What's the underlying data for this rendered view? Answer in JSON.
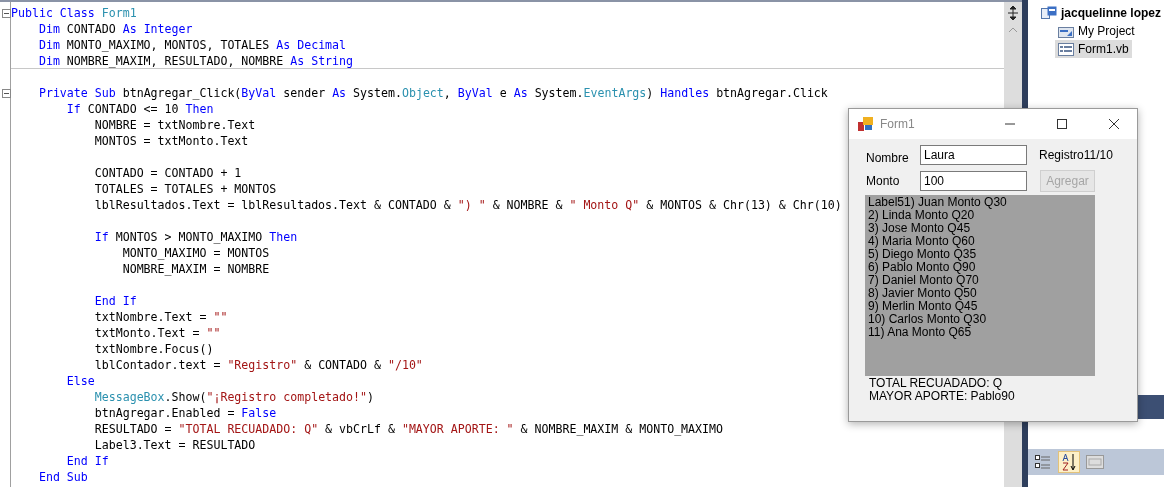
{
  "editor": {
    "lines": [
      {
        "kind": "code",
        "foldable": true,
        "tokens": [
          {
            "kind": "keyword",
            "text": "Public Class "
          },
          {
            "kind": "type",
            "text": "Form1"
          }
        ]
      },
      {
        "kind": "code",
        "tokens": [
          {
            "kind": "keyword",
            "text": "    Dim "
          },
          {
            "kind": "plain",
            "text": "CONTADO "
          },
          {
            "kind": "keyword",
            "text": "As Integer"
          }
        ]
      },
      {
        "kind": "code",
        "tokens": [
          {
            "kind": "keyword",
            "text": "    Dim "
          },
          {
            "kind": "plain",
            "text": "MONTO_MAXIMO, MONTOS, TOTALES "
          },
          {
            "kind": "keyword",
            "text": "As Decimal"
          }
        ]
      },
      {
        "kind": "code",
        "separator": true,
        "tokens": [
          {
            "kind": "keyword",
            "text": "    Dim "
          },
          {
            "kind": "plain",
            "text": "NOMBRE_MAXIM, RESULTADO, NOMBRE "
          },
          {
            "kind": "keyword",
            "text": "As String"
          }
        ]
      },
      {
        "kind": "blank"
      },
      {
        "kind": "code",
        "foldable": true,
        "tokens": [
          {
            "kind": "keyword",
            "text": "    Private Sub "
          },
          {
            "kind": "plain",
            "text": "btnAgregar_Click("
          },
          {
            "kind": "keyword",
            "text": "ByVal "
          },
          {
            "kind": "plain",
            "text": "sender "
          },
          {
            "kind": "keyword",
            "text": "As "
          },
          {
            "kind": "plain",
            "text": "System."
          },
          {
            "kind": "type",
            "text": "Object"
          },
          {
            "kind": "plain",
            "text": ", "
          },
          {
            "kind": "keyword",
            "text": "ByVal "
          },
          {
            "kind": "plain",
            "text": "e "
          },
          {
            "kind": "keyword",
            "text": "As "
          },
          {
            "kind": "plain",
            "text": "System."
          },
          {
            "kind": "type",
            "text": "EventArgs"
          },
          {
            "kind": "plain",
            "text": ") "
          },
          {
            "kind": "keyword",
            "text": "Handles "
          },
          {
            "kind": "plain",
            "text": "btnAgregar.Click"
          }
        ]
      },
      {
        "kind": "code",
        "tokens": [
          {
            "kind": "keyword",
            "text": "        If "
          },
          {
            "kind": "plain",
            "text": "CONTADO <= 10 "
          },
          {
            "kind": "keyword",
            "text": "Then"
          }
        ]
      },
      {
        "kind": "code",
        "tokens": [
          {
            "kind": "plain",
            "text": "            NOMBRE = txtNombre.Text"
          }
        ]
      },
      {
        "kind": "code",
        "tokens": [
          {
            "kind": "plain",
            "text": "            MONTOS = txtMonto.Text"
          }
        ]
      },
      {
        "kind": "blank"
      },
      {
        "kind": "code",
        "tokens": [
          {
            "kind": "plain",
            "text": "            CONTADO = CONTADO + 1"
          }
        ]
      },
      {
        "kind": "code",
        "tokens": [
          {
            "kind": "plain",
            "text": "            TOTALES = TOTALES + MONTOS"
          }
        ]
      },
      {
        "kind": "code",
        "tokens": [
          {
            "kind": "plain",
            "text": "            lblResultados.Text = lblResultados.Text & CONTADO & "
          },
          {
            "kind": "string",
            "text": "\") \""
          },
          {
            "kind": "plain",
            "text": " & NOMBRE & "
          },
          {
            "kind": "string",
            "text": "\" Monto Q\""
          },
          {
            "kind": "plain",
            "text": " & MONTOS & Chr(13) & Chr(10)"
          }
        ]
      },
      {
        "kind": "blank"
      },
      {
        "kind": "code",
        "tokens": [
          {
            "kind": "keyword",
            "text": "            If "
          },
          {
            "kind": "plain",
            "text": "MONTOS > MONTO_MAXIMO "
          },
          {
            "kind": "keyword",
            "text": "Then"
          }
        ]
      },
      {
        "kind": "code",
        "tokens": [
          {
            "kind": "plain",
            "text": "                MONTO_MAXIMO = MONTOS"
          }
        ]
      },
      {
        "kind": "code",
        "tokens": [
          {
            "kind": "plain",
            "text": "                NOMBRE_MAXIM = NOMBRE"
          }
        ]
      },
      {
        "kind": "blank"
      },
      {
        "kind": "code",
        "tokens": [
          {
            "kind": "keyword",
            "text": "            End If"
          }
        ]
      },
      {
        "kind": "code",
        "tokens": [
          {
            "kind": "plain",
            "text": "            txtNombre.Text = "
          },
          {
            "kind": "string",
            "text": "\"\""
          }
        ]
      },
      {
        "kind": "code",
        "tokens": [
          {
            "kind": "plain",
            "text": "            txtMonto.Text = "
          },
          {
            "kind": "string",
            "text": "\"\""
          }
        ]
      },
      {
        "kind": "code",
        "tokens": [
          {
            "kind": "plain",
            "text": "            txtNombre.Focus()"
          }
        ]
      },
      {
        "kind": "code",
        "tokens": [
          {
            "kind": "plain",
            "text": "            lblContador.text = "
          },
          {
            "kind": "string",
            "text": "\"Registro\""
          },
          {
            "kind": "plain",
            "text": " & CONTADO & "
          },
          {
            "kind": "string",
            "text": "\"/10\""
          }
        ]
      },
      {
        "kind": "code",
        "tokens": [
          {
            "kind": "keyword",
            "text": "        Else"
          }
        ]
      },
      {
        "kind": "code",
        "tokens": [
          {
            "kind": "type",
            "text": "            MessageBox"
          },
          {
            "kind": "plain",
            "text": ".Show("
          },
          {
            "kind": "string",
            "text": "\"¡Registro completado!\""
          },
          {
            "kind": "plain",
            "text": ")"
          }
        ]
      },
      {
        "kind": "code",
        "tokens": [
          {
            "kind": "plain",
            "text": "            btnAgregar.Enabled = "
          },
          {
            "kind": "keyword",
            "text": "False"
          }
        ]
      },
      {
        "kind": "code",
        "tokens": [
          {
            "kind": "plain",
            "text": "            RESULTADO = "
          },
          {
            "kind": "string",
            "text": "\"TOTAL RECUADADO: Q\""
          },
          {
            "kind": "plain",
            "text": " & vbCrLf & "
          },
          {
            "kind": "string",
            "text": "\"MAYOR APORTE: \""
          },
          {
            "kind": "plain",
            "text": " & NOMBRE_MAXIM & MONTO_MAXIMO"
          }
        ]
      },
      {
        "kind": "code",
        "tokens": [
          {
            "kind": "plain",
            "text": "            Label3.Text = RESULTADO"
          }
        ]
      },
      {
        "kind": "code",
        "tokens": [
          {
            "kind": "keyword",
            "text": "        End If"
          }
        ]
      },
      {
        "kind": "code",
        "tokens": [
          {
            "kind": "keyword",
            "text": "    End Sub"
          }
        ]
      }
    ]
  },
  "solution_explorer": {
    "items": [
      {
        "label": "jacquelinne lopez",
        "kind": "solution",
        "selected": false
      },
      {
        "label": "My Project",
        "kind": "project",
        "selected": false
      },
      {
        "label": "Form1.vb",
        "kind": "form",
        "selected": true
      }
    ]
  },
  "form_window": {
    "title": "Form1",
    "nombre_label": "Nombre",
    "nombre_value": "Laura",
    "counter": "Registro11/10",
    "monto_label": "Monto",
    "monto_value": "100",
    "add_button": {
      "label": "Agregar",
      "disabled": true
    },
    "results": [
      "Label51) Juan Monto Q30",
      "2) Linda Monto Q20",
      "3) Jose Monto Q45",
      "4) Maria Monto Q60",
      "5) Diego Monto Q35",
      "6) Pablo Monto Q90",
      "7) Daniel Monto Q70",
      "8) Javier Monto Q50",
      "9) Merlin Monto Q45",
      "10) Carlos Monto Q30",
      "11) Ana Monto Q65"
    ],
    "summary": [
      "TOTAL RECUADADO: Q",
      "MAYOR APORTE: Pablo90"
    ]
  }
}
